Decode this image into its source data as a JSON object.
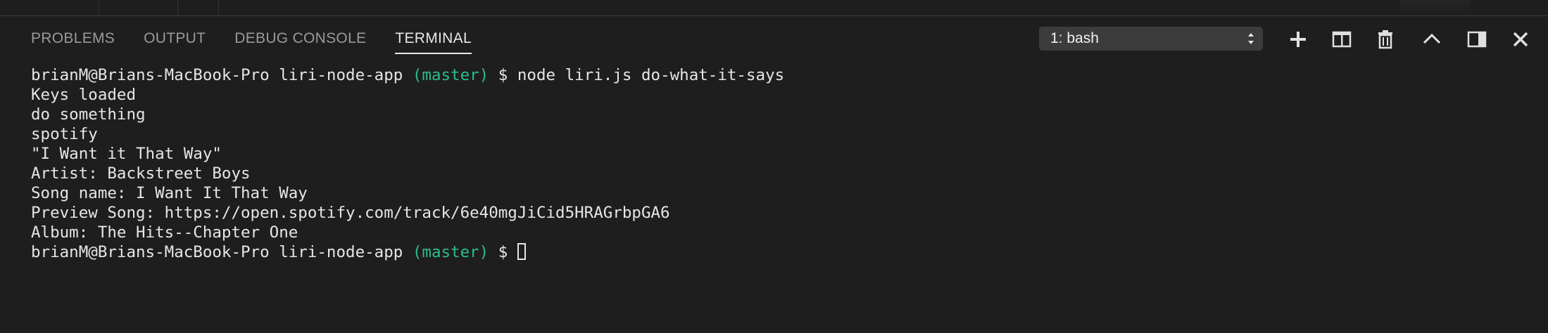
{
  "panel": {
    "tabs": [
      {
        "label": "PROBLEMS",
        "active": false
      },
      {
        "label": "OUTPUT",
        "active": false
      },
      {
        "label": "DEBUG CONSOLE",
        "active": false
      },
      {
        "label": "TERMINAL",
        "active": true
      }
    ],
    "terminal_select": {
      "value": "1: bash"
    },
    "actions": [
      "plus-icon",
      "split-icon",
      "trash-icon",
      "chevron-up-icon",
      "maximize-icon",
      "close-icon"
    ]
  },
  "terminal": {
    "prompt_prefix": "brianM@Brians-MacBook-Pro liri-node-app ",
    "branch": "(master)",
    "prompt_symbol": " $ ",
    "command": "node liri.js do-what-it-says",
    "output": [
      "Keys loaded",
      "do something",
      "spotify",
      "\"I Want it That Way\"",
      "Artist: Backstreet Boys",
      "Song name: I Want It That Way",
      "Preview Song: https://open.spotify.com/track/6e40mgJiCid5HRAGrbpGA6",
      "Album: The Hits--Chapter One"
    ]
  },
  "colors": {
    "background": "#1e1e1e",
    "branch": "#2cbd8a",
    "tab_active": "#e7e7e7",
    "tab_inactive": "#9a9a9a"
  }
}
